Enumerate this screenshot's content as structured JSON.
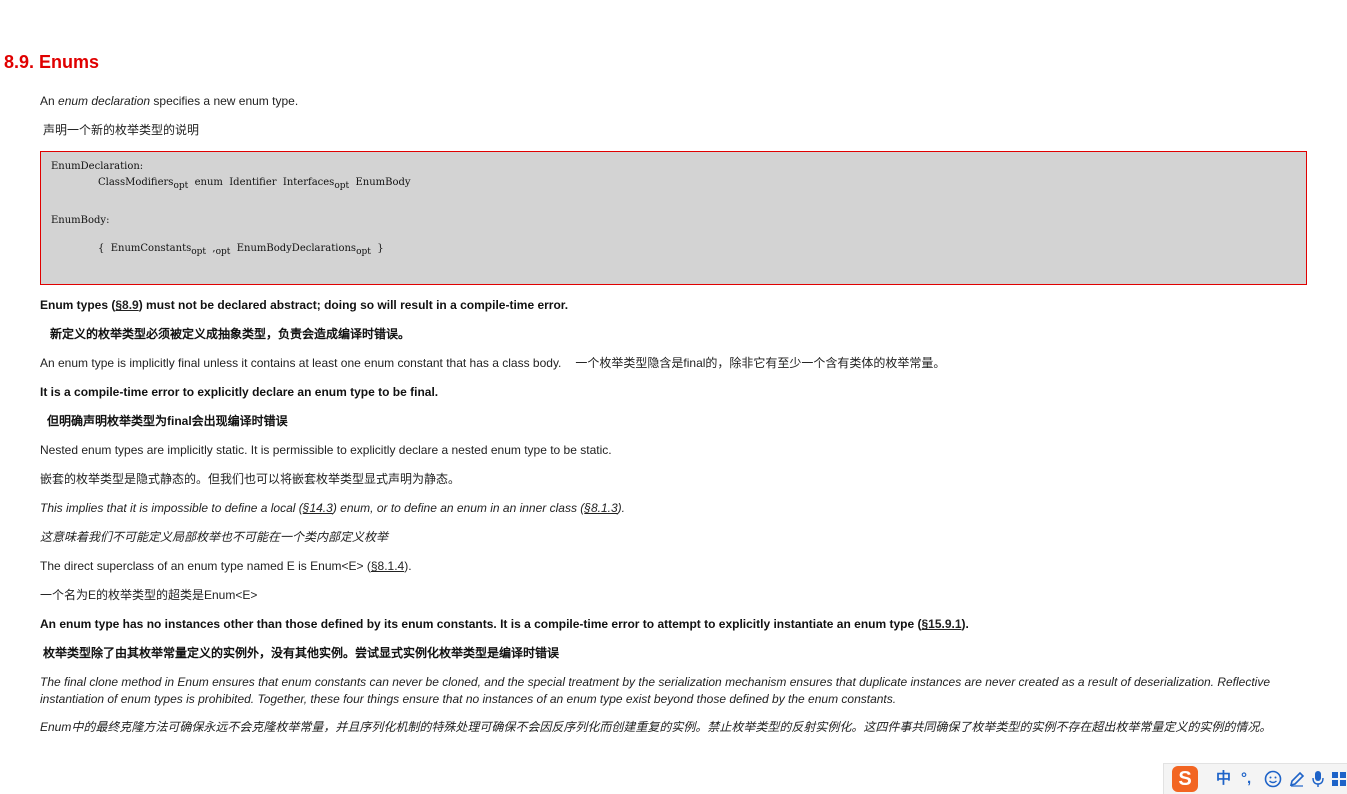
{
  "heading": {
    "number": "8.9.",
    "title": "Enums"
  },
  "p1": {
    "pre": "An ",
    "em": "enum declaration",
    "post": " specifies a new enum type."
  },
  "p1_cn": "声明一个新的枚举类型的说明",
  "grammar": {
    "decl_label": "EnumDeclaration:",
    "decl_mod": "ClassModifiers",
    "decl_kw": "enum",
    "decl_id": "Identifier",
    "decl_if": "Interfaces",
    "decl_body": "EnumBody",
    "opt": "opt",
    "body_label": "EnumBody:",
    "lbrace": "{",
    "body_consts": "EnumConstants",
    "comma": ",",
    "body_decls": "EnumBodyDeclarations",
    "rbrace": "}"
  },
  "p2": {
    "pre": "Enum types (",
    "link": "§8.9",
    "post": ") must not be declared abstract; doing so will result in a compile-time error."
  },
  "p2_cn": "新定义的枚举类型必须被定义成抽象类型，负责会造成编译时错误。",
  "p3": "An enum type is implicitly final unless it contains at least one enum constant that has a class body.",
  "p3_cn": "一个枚举类型隐含是final的，除非它有至少一个含有类体的枚举常量。",
  "p4": "It is a compile-time error to explicitly declare an enum type to be final.",
  "p4_cn": "但明确声明枚举类型为final会出现编译时错误",
  "p5": "Nested enum types are implicitly static. It is permissible to explicitly declare a nested enum type to be static.",
  "p5_cn": "嵌套的枚举类型是隐式静态的。但我们也可以将嵌套枚举类型显式声明为静态。",
  "p6": {
    "pre": "This implies that it is impossible to define a local (",
    "link1": "§14.3",
    "mid": ") enum, or to define an enum in an inner class (",
    "link2": "§8.1.3",
    "post": ")."
  },
  "p6_cn": "这意味着我们不可能定义局部枚举也不可能在一个类内部定义枚举",
  "p7": {
    "pre": "The direct superclass of an enum type named E is Enum<E> (",
    "link": "§8.1.4",
    "post": ")."
  },
  "p7_cn": "一个名为E的枚举类型的超类是Enum<E>",
  "p8": {
    "pre": "An enum type has no instances other than those defined by its enum constants. It is a compile-time error to attempt to explicitly instantiate an enum type (",
    "link": "§15.9.1",
    "post": ")."
  },
  "p8_cn": "枚举类型除了由其枚举常量定义的实例外，没有其他实例。尝试显式实例化枚举类型是编译时错误",
  "p9": "The final clone method in Enum ensures that enum constants can never be cloned, and the special treatment by the serialization mechanism ensures that duplicate instances are never created as a result of deserialization. Reflective instantiation of enum types is prohibited. Together, these four things ensure that no instances of an enum type exist beyond those defined by the enum constants.",
  "p9_cn": "Enum中的最终克隆方法可确保永远不会克隆枚举常量，并且序列化机制的特殊处理可确保不会因反序列化而创建重复的实例。禁止枚举类型的反射实例化。这四件事共同确保了枚举类型的实例不存在超出枚举常量定义的实例的情况。",
  "ime": {
    "logo": "S",
    "lang": "中",
    "punct": "°,",
    "emoji_icon": "smiley-icon",
    "pen_icon": "pen-icon",
    "mic_icon": "microphone-icon",
    "grid_icon": "grid-icon"
  }
}
